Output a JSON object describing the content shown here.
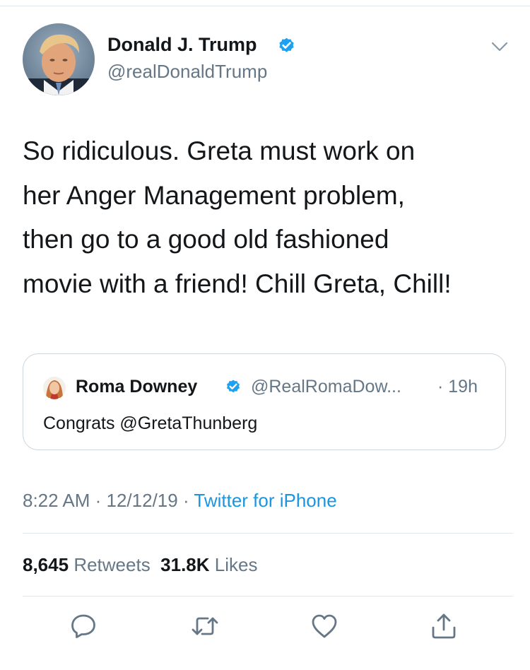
{
  "author": {
    "name": "Donald J. Trump",
    "handle": "@realDonaldTrump",
    "verified": true
  },
  "tweet": {
    "lines": [
      "So ridiculous. Greta must work on",
      "her Anger Management problem,",
      "then go to a good old fashioned",
      "movie with a friend! Chill Greta, Chill!"
    ]
  },
  "quoted": {
    "name": "Roma Downey",
    "handle": "@RealRomaDow...",
    "time": "· 19h",
    "text": "Congrats @GretaThunberg",
    "verified": true
  },
  "meta": {
    "time": "8:22 AM",
    "sep1": " · ",
    "date": "12/12/19",
    "sep2": " · ",
    "source": "Twitter for iPhone"
  },
  "stats": {
    "retweets_count": "8,645",
    "retweets_label": "Retweets",
    "likes_count": "31.8K",
    "likes_label": "Likes"
  },
  "icons": {
    "verified": "verified-badge-icon",
    "menu": "chevron-down-icon",
    "reply": "reply-icon",
    "retweet": "retweet-icon",
    "like": "heart-icon",
    "share": "share-icon"
  },
  "colors": {
    "link": "#1b95e0",
    "secondary_text": "#657786",
    "primary_text": "#14171a",
    "divider": "#e1e8ed"
  }
}
